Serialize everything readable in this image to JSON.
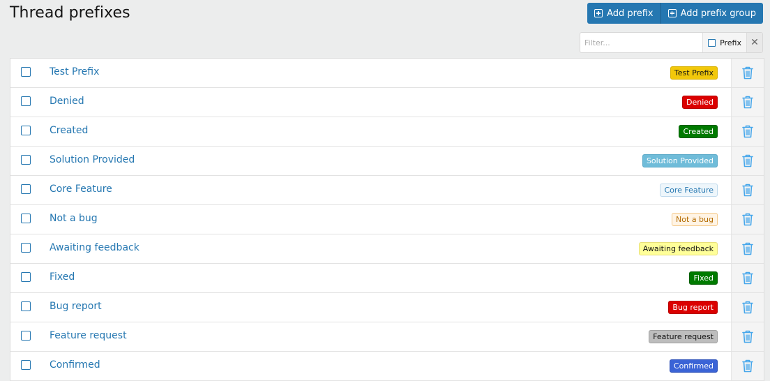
{
  "header": {
    "title": "Thread prefixes",
    "add_prefix_label": "Add prefix",
    "add_prefix_group_label": "Add prefix group"
  },
  "filter": {
    "placeholder": "Filter...",
    "prefix_label": "Prefix",
    "clear_symbol": "✕"
  },
  "prefixes": [
    {
      "title": "Test Prefix",
      "label": "Test Prefix",
      "label_bg": "#f2c80a",
      "label_fg": "#141414",
      "label_border": "#d8b000"
    },
    {
      "title": "Denied",
      "label": "Denied",
      "label_bg": "#db0000",
      "label_fg": "#ffffff",
      "label_border": "#b80000"
    },
    {
      "title": "Created",
      "label": "Created",
      "label_bg": "#007a00",
      "label_fg": "#ffffff",
      "label_border": "#005e00"
    },
    {
      "title": "Solution Provided",
      "label": "Solution Provided",
      "label_bg": "#6fbcd9",
      "label_fg": "#ffffff",
      "label_border": "#5aa9c8"
    },
    {
      "title": "Core Feature",
      "label": "Core Feature",
      "label_bg": "#eef6fb",
      "label_fg": "#2577b1",
      "label_border": "#bfd9ec"
    },
    {
      "title": "Not a bug",
      "label": "Not a bug",
      "label_bg": "#fff4e5",
      "label_fg": "#b46b00",
      "label_border": "#f4c98a"
    },
    {
      "title": "Awaiting feedback",
      "label": "Awaiting feedback",
      "label_bg": "#ffff99",
      "label_fg": "#141414",
      "label_border": "#e8e07a"
    },
    {
      "title": "Fixed",
      "label": "Fixed",
      "label_bg": "#007a00",
      "label_fg": "#ffffff",
      "label_border": "#005e00"
    },
    {
      "title": "Bug report",
      "label": "Bug report",
      "label_bg": "#db0000",
      "label_fg": "#ffffff",
      "label_border": "#b80000"
    },
    {
      "title": "Feature request",
      "label": "Feature request",
      "label_bg": "#bdbdbd",
      "label_fg": "#141414",
      "label_border": "#a0a0a0"
    },
    {
      "title": "Confirmed",
      "label": "Confirmed",
      "label_bg": "#3a63d6",
      "label_fg": "#ffffff",
      "label_border": "#2b4fb8"
    }
  ],
  "icons": {
    "add": "plus-square-icon",
    "delete": "trash-icon",
    "checkbox": "checkbox-icon"
  },
  "colors": {
    "accent": "#2577b1",
    "delete_icon": "#47a7eb"
  }
}
